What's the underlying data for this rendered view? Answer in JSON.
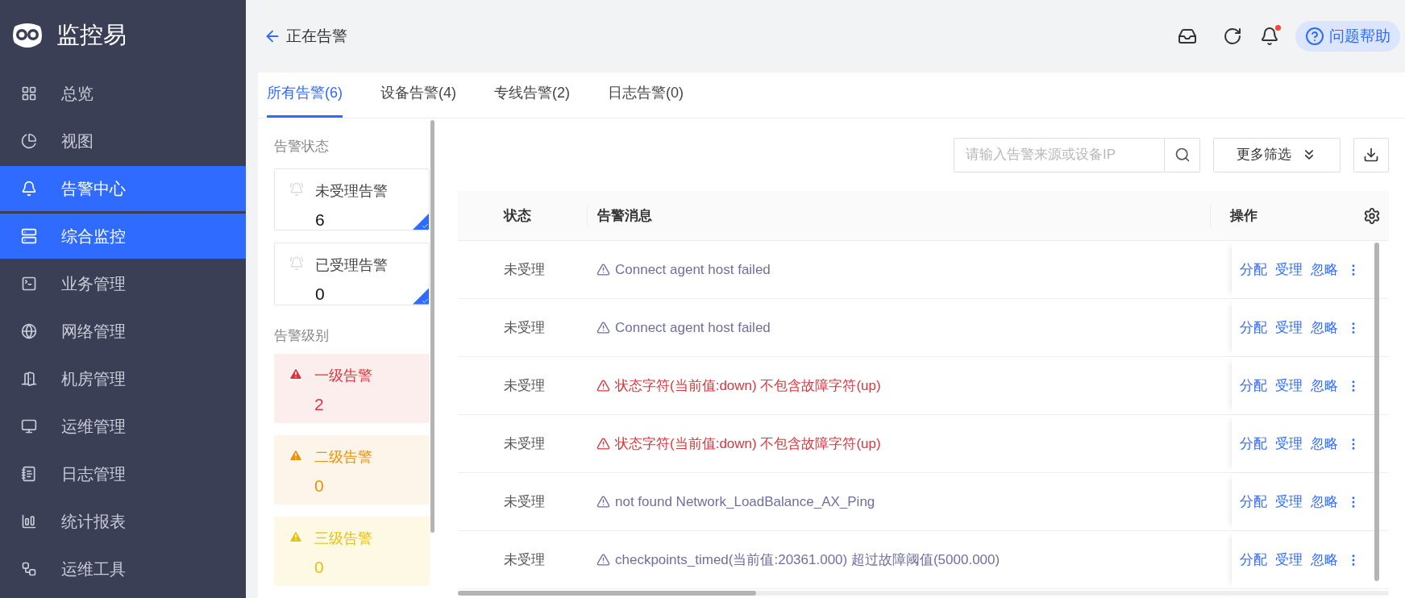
{
  "app": {
    "name": "监控易"
  },
  "sidebar": {
    "items": [
      {
        "label": "总览",
        "selected": false
      },
      {
        "label": "视图",
        "selected": false
      },
      {
        "label": "告警中心",
        "selected": true
      },
      {
        "label": "综合监控",
        "selected": true
      },
      {
        "label": "业务管理",
        "selected": false
      },
      {
        "label": "网络管理",
        "selected": false
      },
      {
        "label": "机房管理",
        "selected": false
      },
      {
        "label": "运维管理",
        "selected": false
      },
      {
        "label": "日志管理",
        "selected": false
      },
      {
        "label": "统计报表",
        "selected": false
      },
      {
        "label": "运维工具",
        "selected": false
      }
    ]
  },
  "header": {
    "title": "正在告警",
    "help": "问题帮助",
    "notification_dot": true
  },
  "tabs": [
    {
      "label": "所有告警(6)",
      "selected": true
    },
    {
      "label": "设备告警(4)",
      "selected": false
    },
    {
      "label": "专线告警(2)",
      "selected": false
    },
    {
      "label": "日志告警(0)",
      "selected": false
    }
  ],
  "filters": {
    "status_title": "告警状态",
    "status_cards": [
      {
        "label": "未受理告警",
        "count": "6",
        "selected": true
      },
      {
        "label": "已受理告警",
        "count": "0",
        "selected": true
      }
    ],
    "level_title": "告警级别",
    "level_cards": [
      {
        "label": "一级告警",
        "count": "2",
        "color": "#d9363e"
      },
      {
        "label": "二级告警",
        "count": "0",
        "color": "#f0900a"
      },
      {
        "label": "三级告警",
        "count": "0",
        "color": "#e8c20c"
      }
    ]
  },
  "search": {
    "placeholder": "请输入告警来源或设备IP"
  },
  "more_filter": "更多筛选",
  "table": {
    "columns": [
      "状态",
      "告警消息",
      "操作"
    ],
    "rows": [
      {
        "status": "未受理",
        "kind": "warning",
        "message": "Connect agent host failed",
        "actions": [
          "分配",
          "受理",
          "忽略"
        ]
      },
      {
        "status": "未受理",
        "kind": "warning",
        "message": "Connect agent host failed",
        "actions": [
          "分配",
          "受理",
          "忽略"
        ]
      },
      {
        "status": "未受理",
        "kind": "critical",
        "message": "状态字符(当前值:down) 不包含故障字符(up)",
        "actions": [
          "分配",
          "受理",
          "忽略"
        ]
      },
      {
        "status": "未受理",
        "kind": "critical",
        "message": "状态字符(当前值:down) 不包含故障字符(up)",
        "actions": [
          "分配",
          "受理",
          "忽略"
        ]
      },
      {
        "status": "未受理",
        "kind": "warning",
        "message": "not found Network_LoadBalance_AX_Ping",
        "actions": [
          "分配",
          "受理",
          "忽略"
        ]
      },
      {
        "status": "未受理",
        "kind": "warning",
        "message": "checkpoints_timed(当前值:20361.000) 超过故障阈值(5000.000)",
        "actions": [
          "分配",
          "受理",
          "忽略"
        ]
      }
    ]
  }
}
